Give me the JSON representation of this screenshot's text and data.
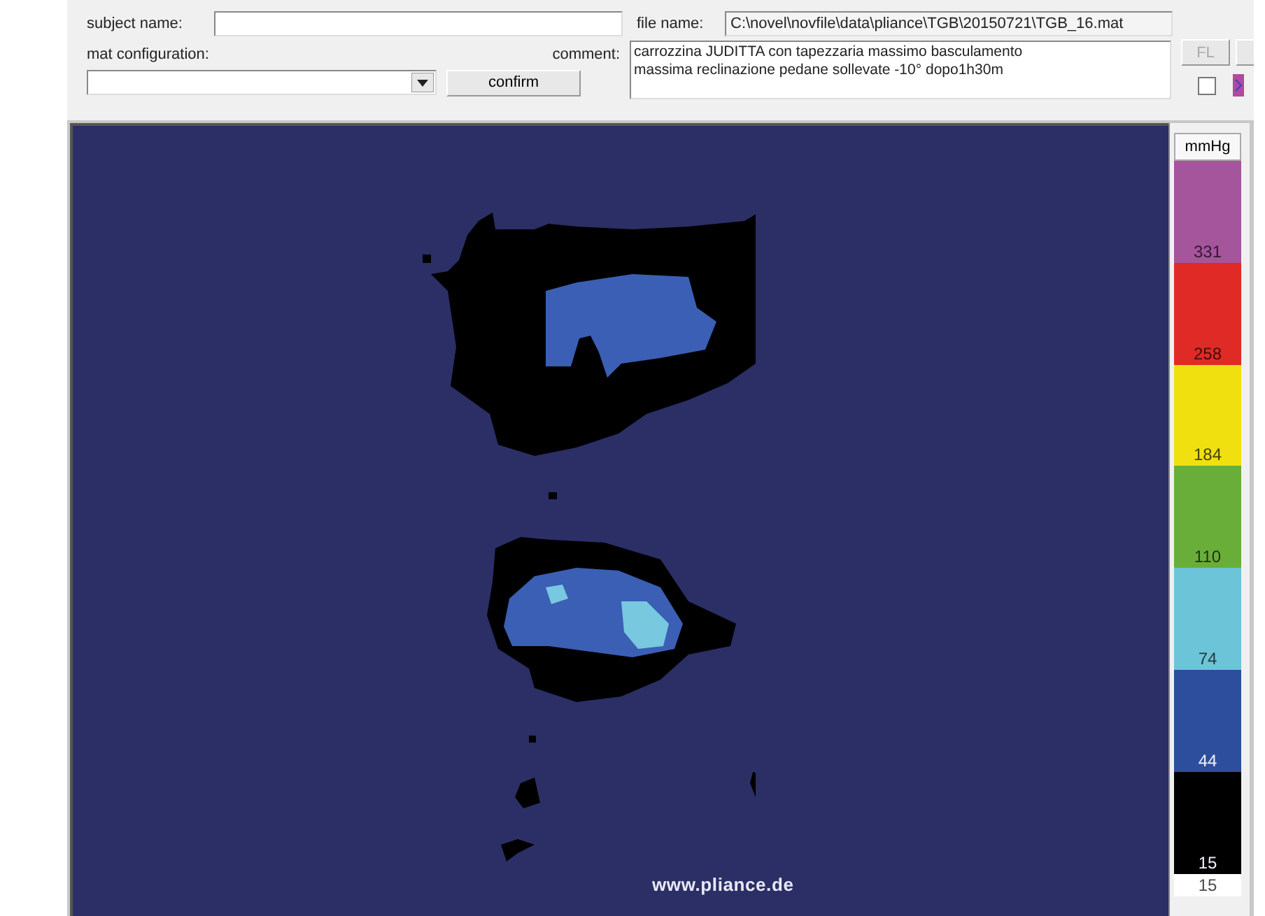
{
  "subject_name": {
    "label": "subject name:"
  },
  "file_name": {
    "label": "file name:",
    "value": "C:\\novel\\novfile\\data\\pliance\\TGB\\20150721\\TGB_16.mat"
  },
  "mat_configuration": {
    "label": "mat configuration:"
  },
  "confirm_button": {
    "label": "confirm"
  },
  "comment": {
    "label": "comment:",
    "value": "carrozzina JUDITTA con tapezzaria massimo basculamento\nmassima reclinazione pedane sollevate -10° dopo1h30m"
  },
  "fl_button": {
    "label": "FL",
    "disabled": true
  },
  "checkbox": {
    "checked": false
  },
  "map": {
    "footer": "www.pliance.de"
  },
  "legend": {
    "unit": "mmHg",
    "levels": [
      {
        "label": "331",
        "color": "#a4559c"
      },
      {
        "label": "258",
        "color": "#e02a26"
      },
      {
        "label": "184",
        "color": "#f0e010"
      },
      {
        "label": "110",
        "color": "#6aae3a"
      },
      {
        "label": "74",
        "color": "#6cc4d8"
      },
      {
        "label": "44",
        "color": "#2d4e9c"
      },
      {
        "label": "15",
        "color": "#000000"
      },
      {
        "label": "15",
        "color": "#ffffff"
      }
    ]
  }
}
